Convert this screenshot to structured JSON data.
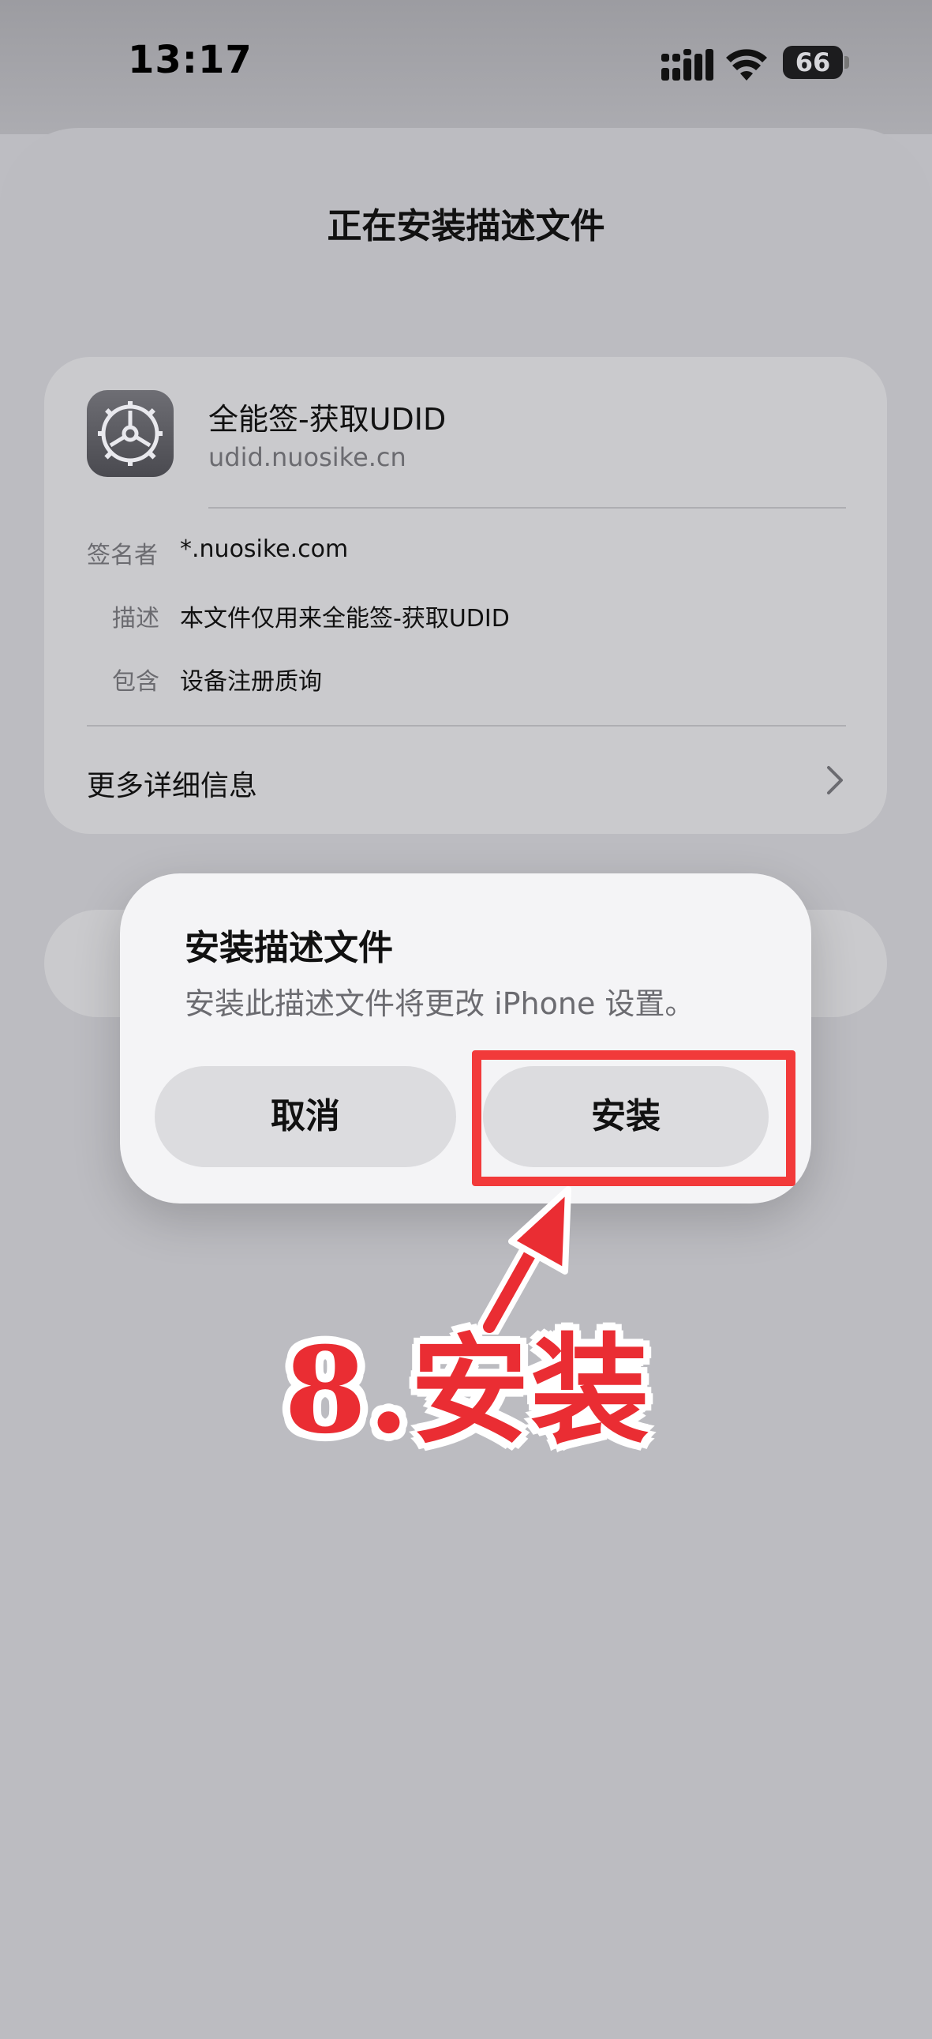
{
  "status_bar": {
    "time": "13:17",
    "battery": "66"
  },
  "sheet": {
    "title": "正在安装描述文件"
  },
  "profile": {
    "name": "全能签-获取UDID",
    "domain": "udid.nuosike.cn",
    "details": [
      {
        "label": "签名者",
        "value": "*.nuosike.com"
      },
      {
        "label": "描述",
        "value": "本文件仅用来全能签-获取UDID"
      },
      {
        "label": "包含",
        "value": "设备注册质询"
      }
    ],
    "more_info": "更多详细信息"
  },
  "alert": {
    "title": "安装描述文件",
    "message": "安装此描述文件将更改 iPhone 设置。",
    "cancel_label": "取消",
    "install_label": "安装"
  },
  "annotation": {
    "step_label": "8.安装",
    "color": "#ea2d33"
  }
}
